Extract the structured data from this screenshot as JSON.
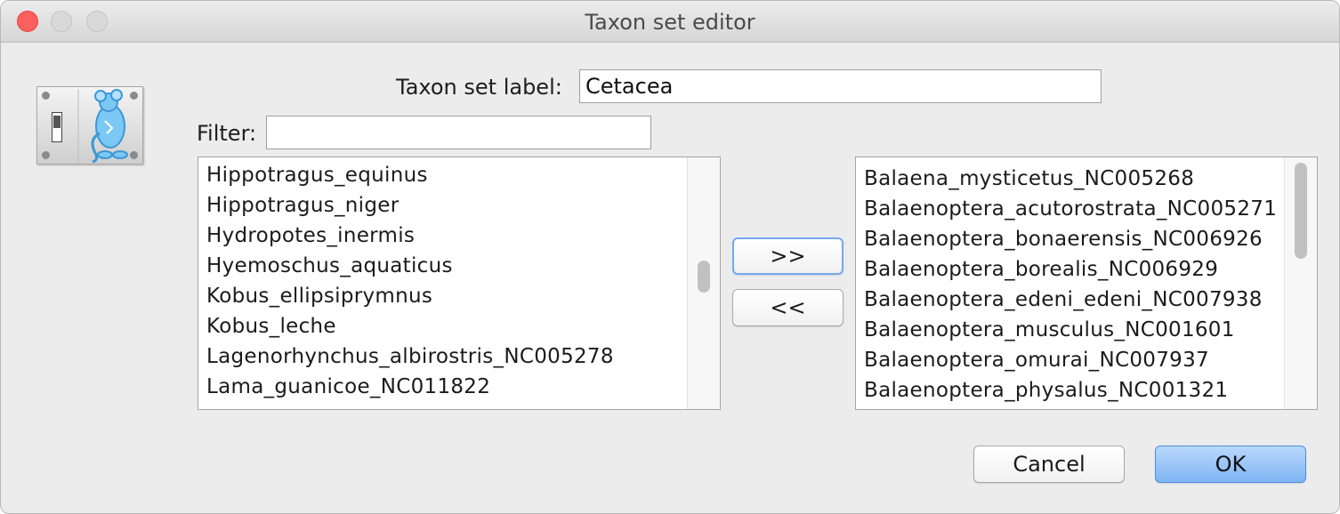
{
  "window": {
    "title": "Taxon set editor"
  },
  "form": {
    "label_text": "Taxon set label:",
    "label_value": "Cetacea",
    "filter_label": "Filter:",
    "filter_value": ""
  },
  "available_taxa": [
    "Hippotragus_equinus",
    "Hippotragus_niger",
    "Hydropotes_inermis",
    "Hyemoschus_aquaticus",
    "Kobus_ellipsiprymnus",
    "Kobus_leche",
    "Lagenorhynchus_albirostris_NC005278",
    "Lama_guanicoe_NC011822"
  ],
  "selected_taxa": [
    "Balaena_mysticetus_NC005268",
    "Balaenoptera_acutorostrata_NC005271",
    "Balaenoptera_bonaerensis_NC006926",
    "Balaenoptera_borealis_NC006929",
    "Balaenoptera_edeni_edeni_NC007938",
    "Balaenoptera_musculus_NC001601",
    "Balaenoptera_omurai_NC007937",
    "Balaenoptera_physalus_NC001321"
  ],
  "buttons": {
    "add": ">>",
    "remove": "<<",
    "cancel": "Cancel",
    "ok": "OK"
  },
  "colors": {
    "close_button": "#fc605c",
    "default_button": "#7fb4f4",
    "focus_ring": "#75a9ec"
  },
  "icons": {
    "app_icon": "mouse-icon"
  }
}
